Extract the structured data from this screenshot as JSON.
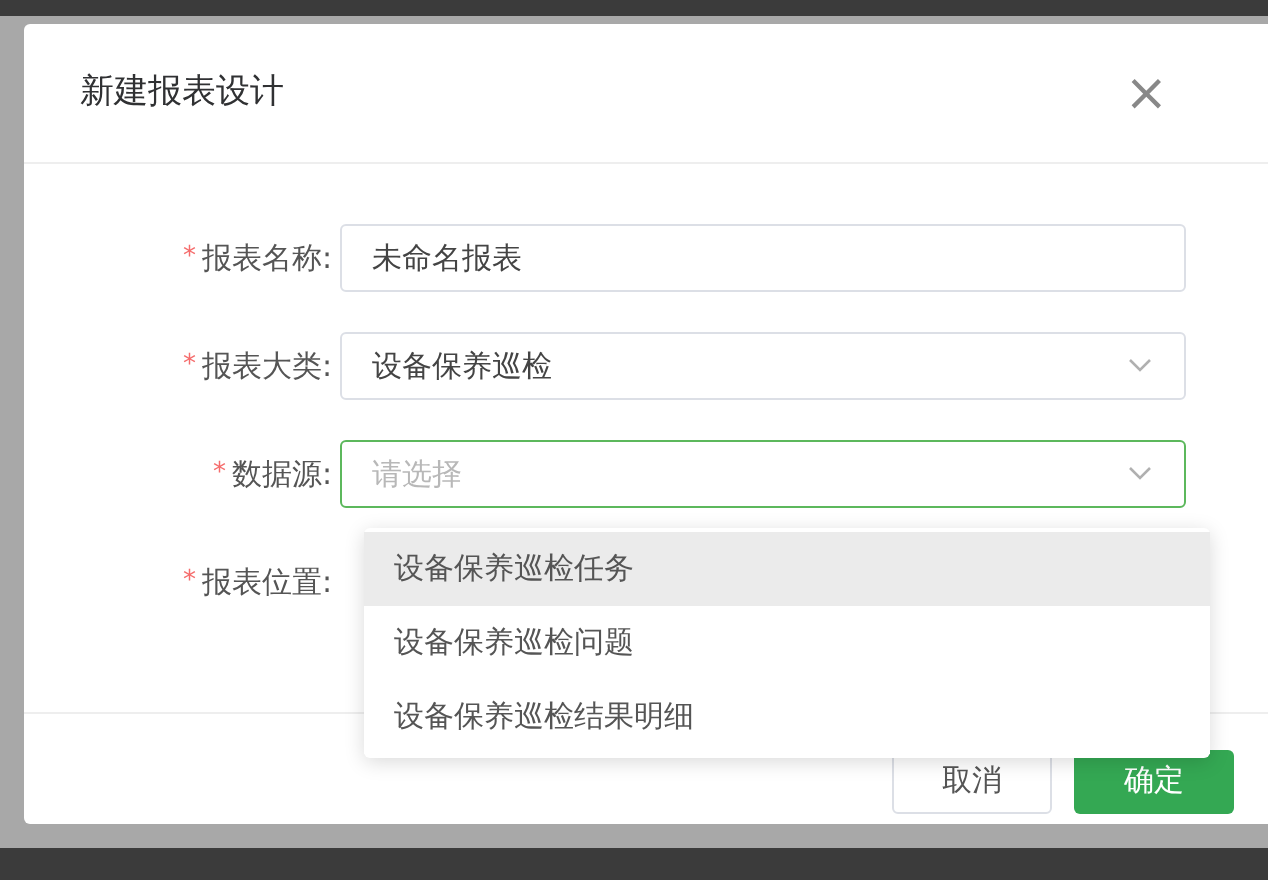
{
  "dialog": {
    "title": "新建报表设计",
    "close": "×",
    "fields": [
      {
        "label": "报表名称:",
        "required_mark": "*",
        "kind": "input",
        "value": "未命名报表",
        "focused": false
      },
      {
        "label": "报表大类:",
        "required_mark": "*",
        "kind": "select",
        "value": "设备保养巡检",
        "focused": false
      },
      {
        "label": "数据源:",
        "required_mark": "*",
        "kind": "select",
        "placeholder": "请选择",
        "focused": true
      },
      {
        "label": "报表位置:",
        "required_mark": "*"
      }
    ],
    "buttons": [
      {
        "label": "取消",
        "kind": "default"
      },
      {
        "label": "确定",
        "kind": "primary"
      }
    ]
  },
  "dropdown": {
    "options": [
      {
        "label": "设备保养巡检任务",
        "highlighted": true
      },
      {
        "label": "设备保养巡检问题",
        "highlighted": false
      },
      {
        "label": "设备保养巡检结果明细",
        "highlighted": false
      }
    ]
  }
}
